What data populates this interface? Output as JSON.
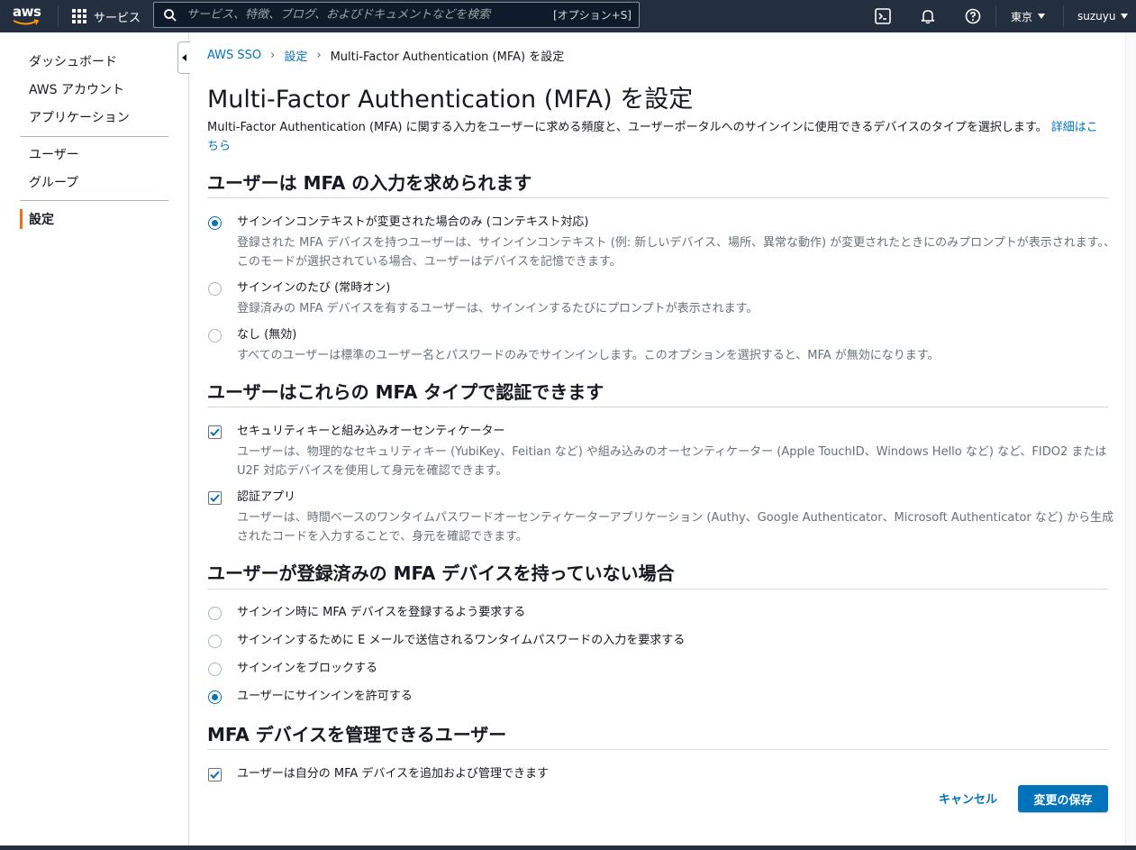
{
  "topnav": {
    "logo_text": "aws",
    "services_label": "サービス",
    "search_placeholder": "サービス、特徴、ブログ、およびドキュメントなどを検索",
    "search_shortcut": "[オプション+S]",
    "region_label": "東京",
    "user_label": "suzuyu",
    "bg_color": "#232f3e"
  },
  "sidebar": {
    "items": [
      {
        "label": "ダッシュボード"
      },
      {
        "label": "AWS アカウント"
      },
      {
        "label": "アプリケーション"
      },
      {
        "label": "ユーザー"
      },
      {
        "label": "グループ"
      },
      {
        "label": "設定",
        "active": true
      }
    ],
    "active_color": "#ec7211"
  },
  "breadcrumb": {
    "items": [
      "AWS SSO",
      "設定"
    ],
    "current": "Multi-Factor Authentication (MFA) を設定"
  },
  "page": {
    "title": "Multi-Factor Authentication (MFA) を設定",
    "description": "Multi-Factor Authentication (MFA) に関する入力をユーザーに求める頻度と、ユーザーポータルへのサインインに使用できるデバイスのタイプを選択します。",
    "learn_more": "詳細はこちら"
  },
  "sections": {
    "prompt": {
      "title": "ユーザーは MFA の入力を求められます",
      "options": [
        {
          "label": "サインインコンテキストが変更された場合のみ (コンテキスト対応)",
          "description": "登録された MFA デバイスを持つユーザーは、サインインコンテキスト (例: 新しいデバイス、場所、異常な動作) が変更されたときにのみプロンプトが表示されます。、このモードが選択されている場合、ユーザーはデバイスを記憶できます。",
          "selected": true
        },
        {
          "label": "サインインのたび (常時オン)",
          "description": "登録済みの MFA デバイスを有するユーザーは、サインインするたびにプロンプトが表示されます。",
          "selected": false
        },
        {
          "label": "なし (無効)",
          "description": "すべてのユーザーは標準のユーザー名とパスワードのみでサインインします。このオプションを選択すると、MFA が無効になります。",
          "selected": false
        }
      ]
    },
    "types": {
      "title": "ユーザーはこれらの MFA タイプで認証できます",
      "options": [
        {
          "label": "セキュリティキーと組み込みオーセンティケーター",
          "description": "ユーザーは、物理的なセキュリティキー (YubiKey、Feitian など) や組み込みのオーセンティケーター (Apple TouchID、Windows Hello など) など、FIDO2 または U2F 対応デバイスを使用して身元を確認できます。",
          "checked": true
        },
        {
          "label": "認証アプリ",
          "description": "ユーザーは、時間ベースのワンタイムパスワードオーセンティケーターアプリケーション (Authy、Google Authenticator、Microsoft Authenticator など) から生成されたコードを入力することで、身元を確認できます。",
          "checked": true
        }
      ]
    },
    "no_device": {
      "title": "ユーザーが登録済みの MFA デバイスを持っていない場合",
      "options": [
        {
          "label": "サインイン時に MFA デバイスを登録するよう要求する",
          "selected": false
        },
        {
          "label": "サインインするために E メールで送信されるワンタイムパスワードの入力を要求する",
          "selected": false
        },
        {
          "label": "サインインをブロックする",
          "selected": false
        },
        {
          "label": "ユーザーにサインインを許可する",
          "selected": true
        }
      ]
    },
    "manage": {
      "title": "MFA デバイスを管理できるユーザー",
      "options": [
        {
          "label": "ユーザーは自分の MFA デバイスを追加および管理できます",
          "checked": true
        }
      ]
    }
  },
  "actions": {
    "cancel_label": "キャンセル",
    "save_label": "変更の保存"
  },
  "colors": {
    "link": "#0073bb",
    "primary_button": "#0073bb",
    "muted_text": "#687078"
  }
}
